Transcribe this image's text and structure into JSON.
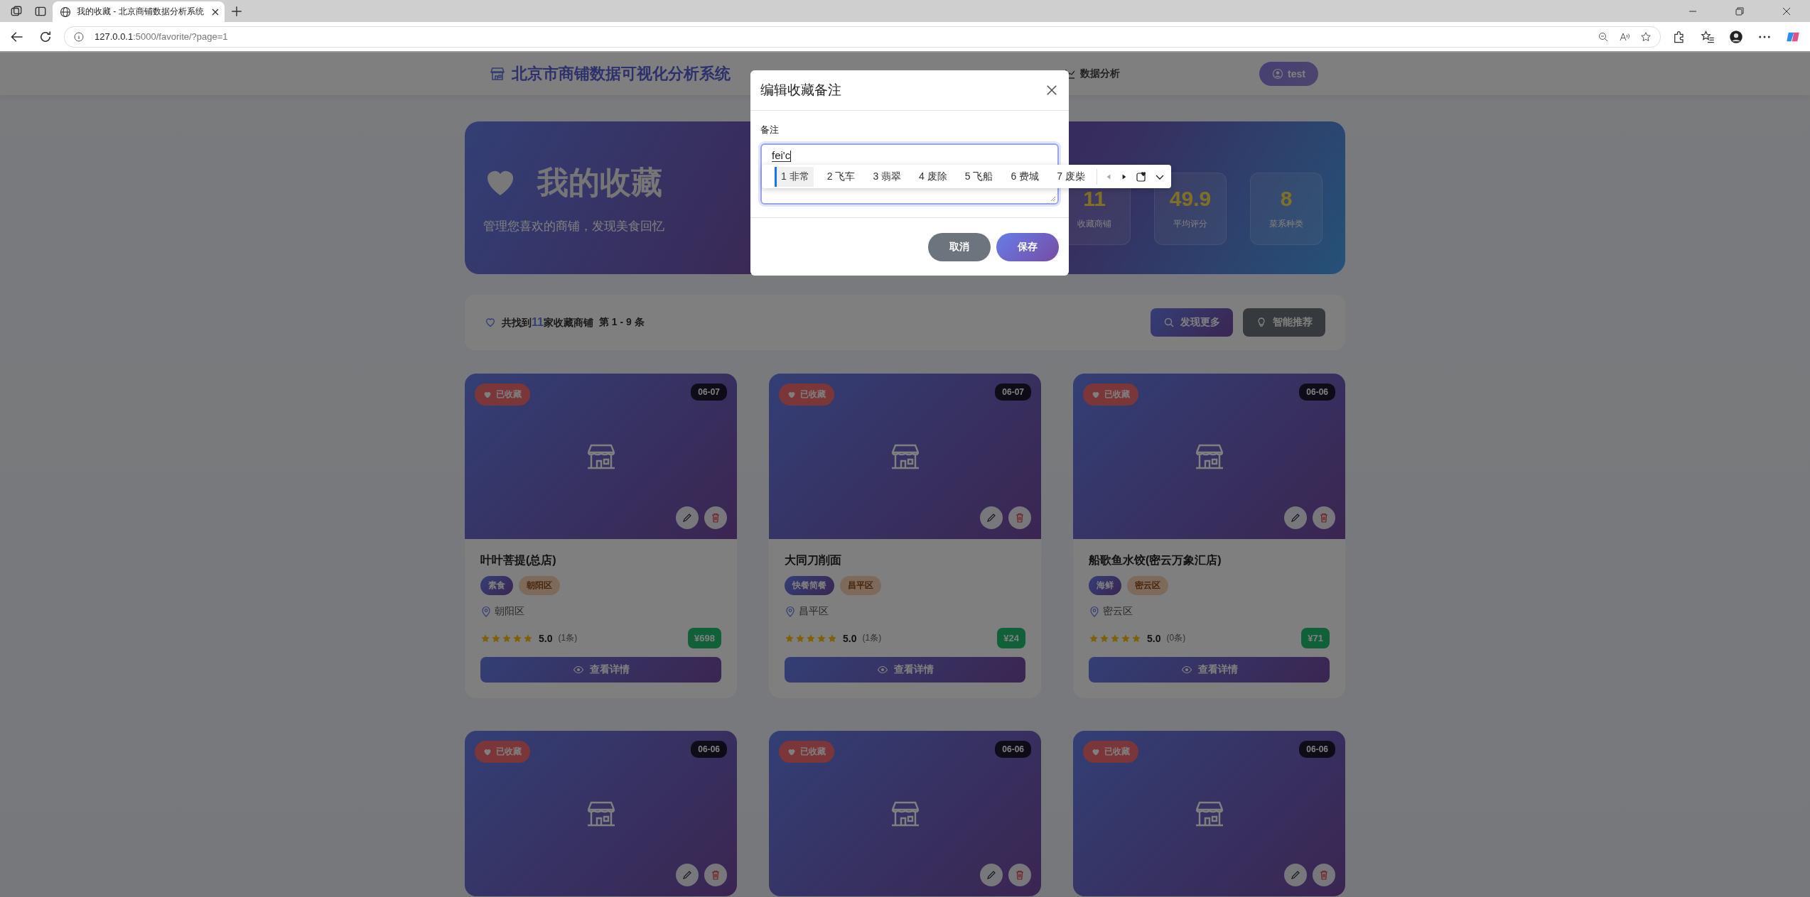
{
  "browser": {
    "tabs": [
      {
        "title": "我的收藏 - 北京商铺数据分析系统",
        "selected": true
      }
    ],
    "url_host": "127.0.0.1",
    "url_path": ":5000/favorite/?page=1"
  },
  "header": {
    "brand": "北京市商铺数据可视化分析系统",
    "nav": [
      {
        "label": "数据分析"
      }
    ],
    "user": "test"
  },
  "hero": {
    "title": "我的收藏",
    "subtitle": "管理您喜欢的商铺，发现美食回忆",
    "stats": [
      {
        "value": "11",
        "label": "收藏商铺"
      },
      {
        "value": "49.9",
        "label": "平均评分"
      },
      {
        "value": "8",
        "label": "菜系种类"
      }
    ]
  },
  "toolbar": {
    "prefix": "共找到",
    "count": "11",
    "suffix": "家收藏商铺",
    "range": "第 1 - 9 条",
    "buttons": [
      {
        "label": "发现更多",
        "kind": "discover"
      },
      {
        "label": "智能推荐",
        "kind": "recommend"
      }
    ]
  },
  "cards": [
    {
      "badge": "已收藏",
      "date": "06-07",
      "name": "叶叶菩提(总店)",
      "tags": [
        {
          "label": "素食",
          "kind": "cuisine"
        },
        {
          "label": "朝阳区",
          "kind": "district"
        }
      ],
      "location": "朝阳区",
      "stars": 5,
      "rating": "5.0",
      "reviews": "(1条)",
      "price": "¥698",
      "action": "查看详情"
    },
    {
      "badge": "已收藏",
      "date": "06-07",
      "name": "大同刀削面",
      "tags": [
        {
          "label": "快餐简餐",
          "kind": "cuisine"
        },
        {
          "label": "昌平区",
          "kind": "district"
        }
      ],
      "location": "昌平区",
      "stars": 5,
      "rating": "5.0",
      "reviews": "(1条)",
      "price": "¥24",
      "action": "查看详情"
    },
    {
      "badge": "已收藏",
      "date": "06-06",
      "name": "船歌鱼水饺(密云万象汇店)",
      "tags": [
        {
          "label": "海鲜",
          "kind": "cuisine"
        },
        {
          "label": "密云区",
          "kind": "district"
        }
      ],
      "location": "密云区",
      "stars": 5,
      "rating": "5.0",
      "reviews": "(0条)",
      "price": "¥71",
      "action": "查看详情"
    },
    {
      "badge": "已收藏",
      "date": "06-06"
    },
    {
      "badge": "已收藏",
      "date": "06-06"
    },
    {
      "badge": "已收藏",
      "date": "06-06"
    }
  ],
  "modal": {
    "title": "编辑收藏备注",
    "field_label": "备注",
    "value": "fei'c",
    "candidates": [
      {
        "label": "1 非常",
        "selected": true
      },
      {
        "label": "2 飞车",
        "selected": false
      },
      {
        "label": "3 翡翠",
        "selected": false
      },
      {
        "label": "4 废除",
        "selected": false
      },
      {
        "label": "5 飞船",
        "selected": false
      },
      {
        "label": "6 费城",
        "selected": false
      },
      {
        "label": "7 废柴",
        "selected": false
      }
    ],
    "buttons": [
      {
        "label": "取消",
        "kind": "cancel"
      },
      {
        "label": "保存",
        "kind": "save"
      }
    ]
  }
}
